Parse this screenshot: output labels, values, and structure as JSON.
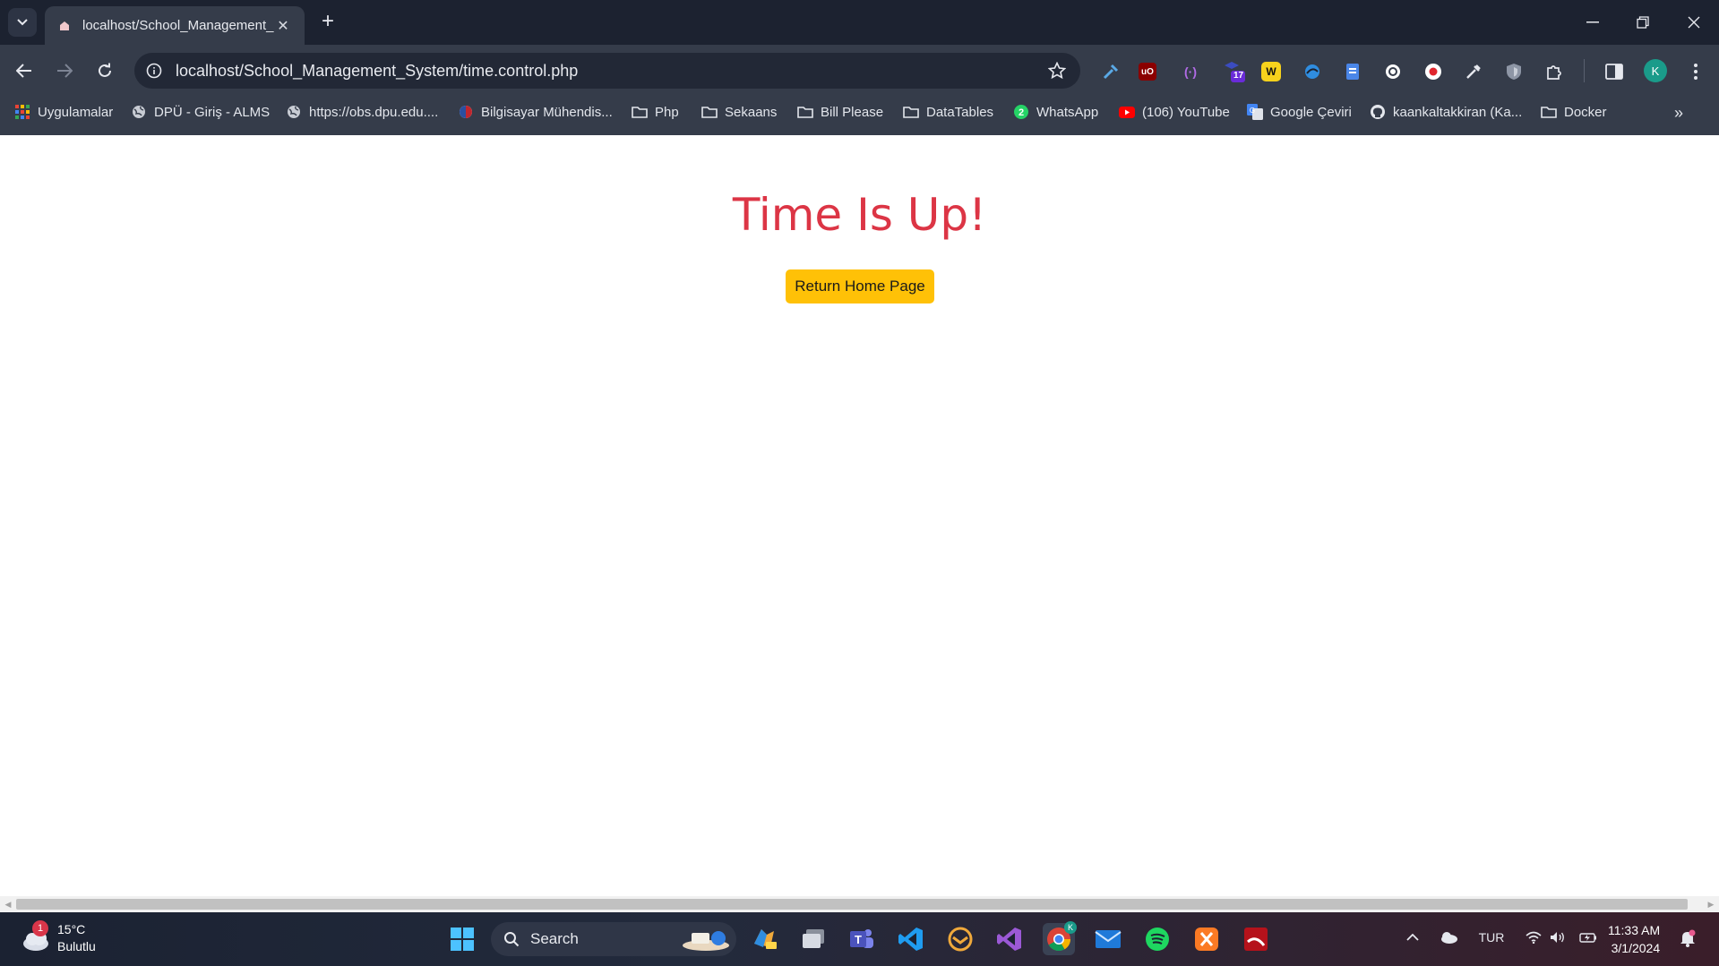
{
  "browser": {
    "tab_title": "localhost/School_Management_System/time.control.php",
    "url": "localhost/School_Management_System/time.control.php"
  },
  "bookmarks": [
    {
      "label": "Uygulamalar",
      "icon": "apps-grid-icon"
    },
    {
      "label": "DPÜ - Giriş - ALMS",
      "icon": "globe-icon"
    },
    {
      "label": "https://obs.dpu.edu....",
      "icon": "globe-icon"
    },
    {
      "label": "Bilgisayar Mühendis...",
      "icon": "site-icon"
    },
    {
      "label": "Php",
      "icon": "folder-icon"
    },
    {
      "label": "Sekaans",
      "icon": "folder-icon"
    },
    {
      "label": "Bill Please",
      "icon": "folder-icon"
    },
    {
      "label": "DataTables",
      "icon": "folder-icon"
    },
    {
      "label": "WhatsApp",
      "icon": "whatsapp-icon"
    },
    {
      "label": "(106) YouTube",
      "icon": "youtube-icon"
    },
    {
      "label": "Google Çeviri",
      "icon": "google-translate-icon"
    },
    {
      "label": "kaankaltakkiran (Ka...",
      "icon": "github-icon"
    },
    {
      "label": "Docker",
      "icon": "folder-icon"
    }
  ],
  "extensions": {
    "badge_count": "17",
    "avatar_initial": "K"
  },
  "page": {
    "title": "Time Is Up!",
    "button_label": "Return Home Page",
    "colors": {
      "title": "#dc3545",
      "button": "#ffc107"
    }
  },
  "taskbar": {
    "weather_temp": "15°C",
    "weather_desc": "Bulutlu",
    "weather_badge": "1",
    "search_label": "Search",
    "language": "TUR",
    "time": "11:33 AM",
    "date": "3/1/2024",
    "chrome_badge": "K"
  }
}
